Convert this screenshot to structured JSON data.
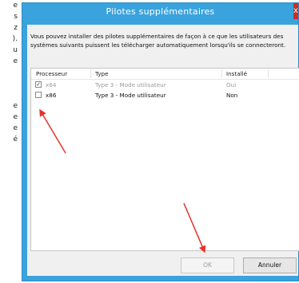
{
  "background_text": [
    "e",
    "s",
    "z",
    ").",
    "u",
    "e",
    "",
    "",
    "",
    "e",
    "e",
    "e",
    "é"
  ],
  "window": {
    "title": "Pilotes supplémentaires",
    "close_label": "x"
  },
  "description": "Vous pouvez installer des pilotes supplémentaires de façon à ce que les utilisateurs des systèmes suivants puissent les télécharger automatiquement lorsqu'ils se connecteront.",
  "list": {
    "columns": [
      "Processeur",
      "Type",
      "Installé"
    ],
    "rows": [
      {
        "processor": "x64",
        "type": "Type 3 - Mode utilisateur",
        "installed": "Oui",
        "checked": true,
        "disabled": true
      },
      {
        "processor": "x86",
        "type": "Type 3 - Mode utilisateur",
        "installed": "Non",
        "checked": false,
        "disabled": false
      }
    ]
  },
  "buttons": {
    "ok": "OK",
    "cancel": "Annuler"
  },
  "colors": {
    "title_bar": "#3aa3dd",
    "close_button": "#c7302b",
    "annotation_arrow": "#e8312b"
  }
}
